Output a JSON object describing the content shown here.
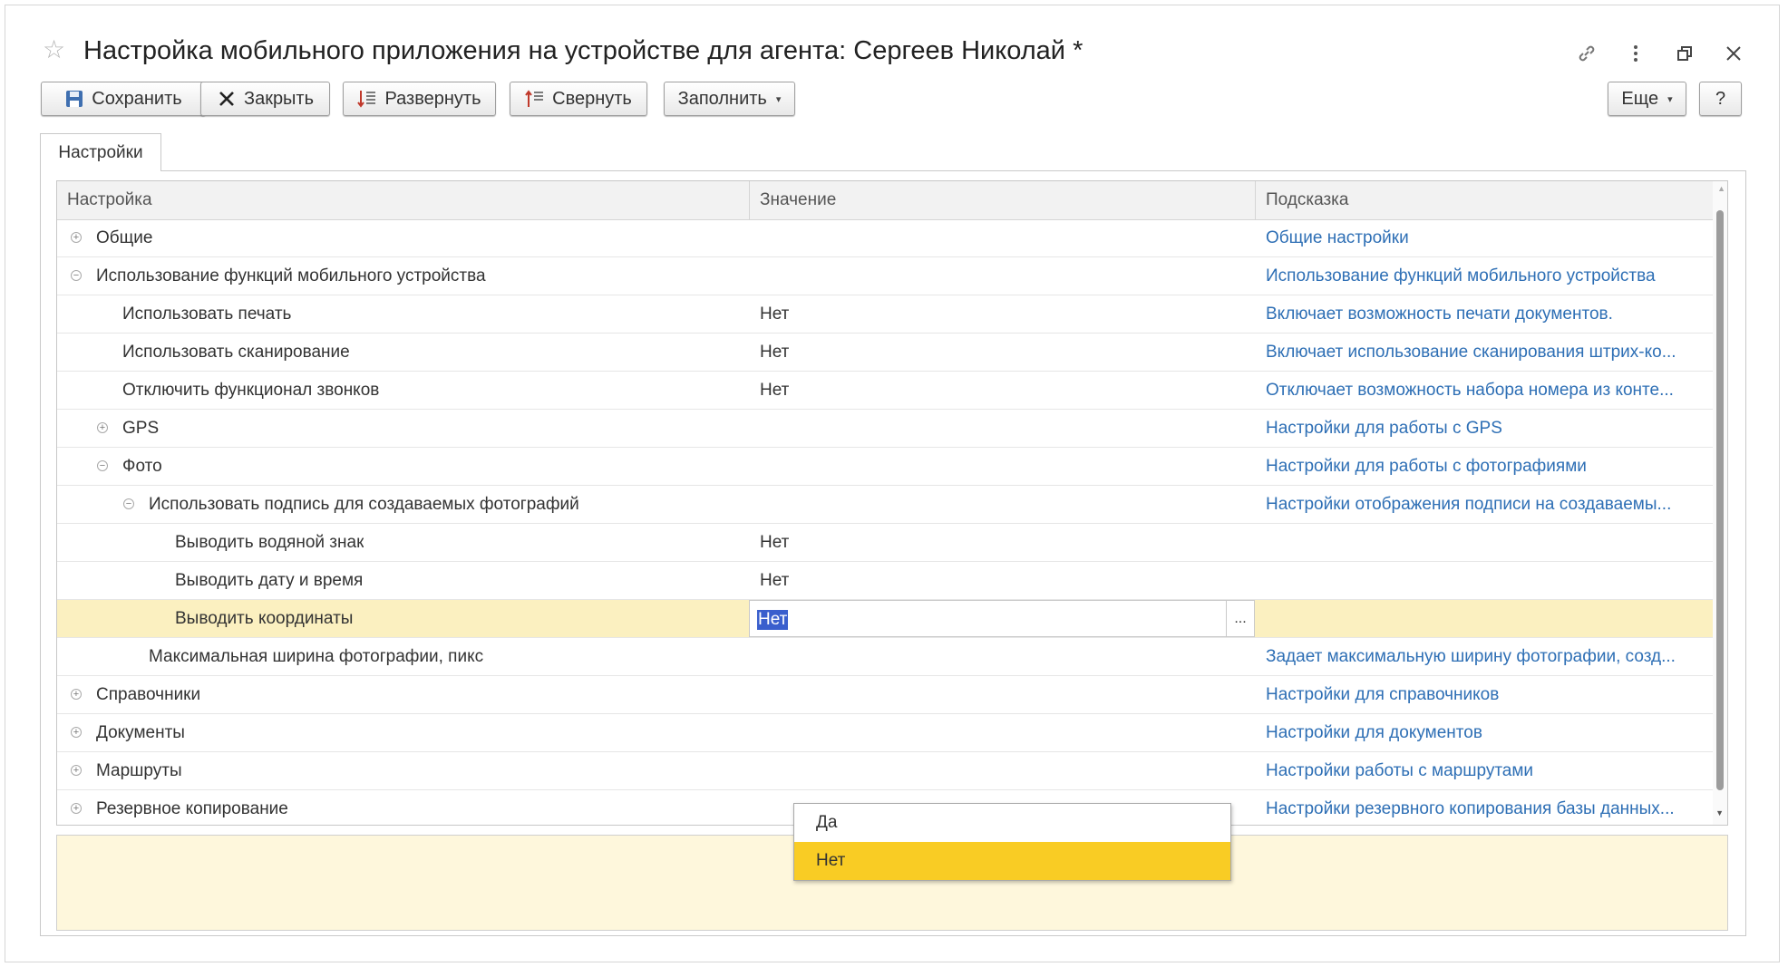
{
  "window": {
    "title": "Настройка мобильного приложения на устройстве для агента: Сергеев Николай *"
  },
  "toolbar": {
    "save_label": "Сохранить",
    "close_label": "Закрыть",
    "expand_label": "Развернуть",
    "collapse_label": "Свернуть",
    "fill_label": "Заполнить",
    "more_label": "Еще",
    "help_label": "?"
  },
  "tabs": [
    {
      "label": "Настройки"
    }
  ],
  "grid": {
    "columns": [
      "Настройка",
      "Значение",
      "Подсказка"
    ],
    "rows": [
      {
        "name": "Общие",
        "value": "",
        "hint": "Общие настройки",
        "expander": "+"
      },
      {
        "name": "Использование функций мобильного устройства",
        "value": "",
        "hint": "Использование функций мобильного устройства",
        "expander": "−"
      },
      {
        "name": "Использовать печать",
        "value": "Нет",
        "hint": "Включает возможность печати документов.",
        "expander": ""
      },
      {
        "name": "Использовать сканирование",
        "value": "Нет",
        "hint": "Включает использование сканирования штрих-ко...",
        "expander": ""
      },
      {
        "name": "Отключить функционал звонков",
        "value": "Нет",
        "hint": "Отключает возможность набора номера из конте...",
        "expander": ""
      },
      {
        "name": "GPS",
        "value": "",
        "hint": "Настройки для работы с GPS",
        "expander": "+"
      },
      {
        "name": "Фото",
        "value": "",
        "hint": "Настройки для работы с фотографиями",
        "expander": "−"
      },
      {
        "name": "Использовать подпись для создаваемых фотографий",
        "value": "",
        "hint": "Настройки отображения подписи на создаваемы...",
        "expander": "−"
      },
      {
        "name": "Выводить водяной знак",
        "value": "Нет",
        "hint": "",
        "expander": ""
      },
      {
        "name": "Выводить дату и время",
        "value": "Нет",
        "hint": "",
        "expander": ""
      },
      {
        "name": "Выводить координаты",
        "value": "Нет",
        "hint": "",
        "expander": "",
        "selected": true
      },
      {
        "name": "Максимальная ширина фотографии, пикс",
        "value": "",
        "hint": "Задает максимальную ширину фотографии, созд...",
        "expander": ""
      },
      {
        "name": "Справочники",
        "value": "",
        "hint": "Настройки для справочников",
        "expander": "+"
      },
      {
        "name": "Документы",
        "value": "",
        "hint": "Настройки для документов",
        "expander": "+"
      },
      {
        "name": "Маршруты",
        "value": "",
        "hint": "Настройки работы с маршрутами",
        "expander": "+"
      },
      {
        "name": "Резервное копирование",
        "value": "",
        "hint": "Настройки резервного копирования базы данных...",
        "expander": "+"
      }
    ],
    "editor": {
      "value": "Нет",
      "choice_button": "..."
    },
    "dropdown": {
      "options": [
        "Да",
        "Нет"
      ],
      "selected": "Нет"
    }
  },
  "icons": [
    "star-icon",
    "link-icon",
    "more-vertical-icon",
    "restore-window-icon",
    "close-icon",
    "save-icon",
    "close-x-icon",
    "expand-tree-icon",
    "collapse-tree-icon"
  ],
  "colors": {
    "hint_text": "#2e6fb5",
    "selected_row": "#fbf0c0",
    "dropdown_active": "#f9cc24",
    "hint_area": "#fef7dc",
    "selection": "#3a5fcd"
  }
}
